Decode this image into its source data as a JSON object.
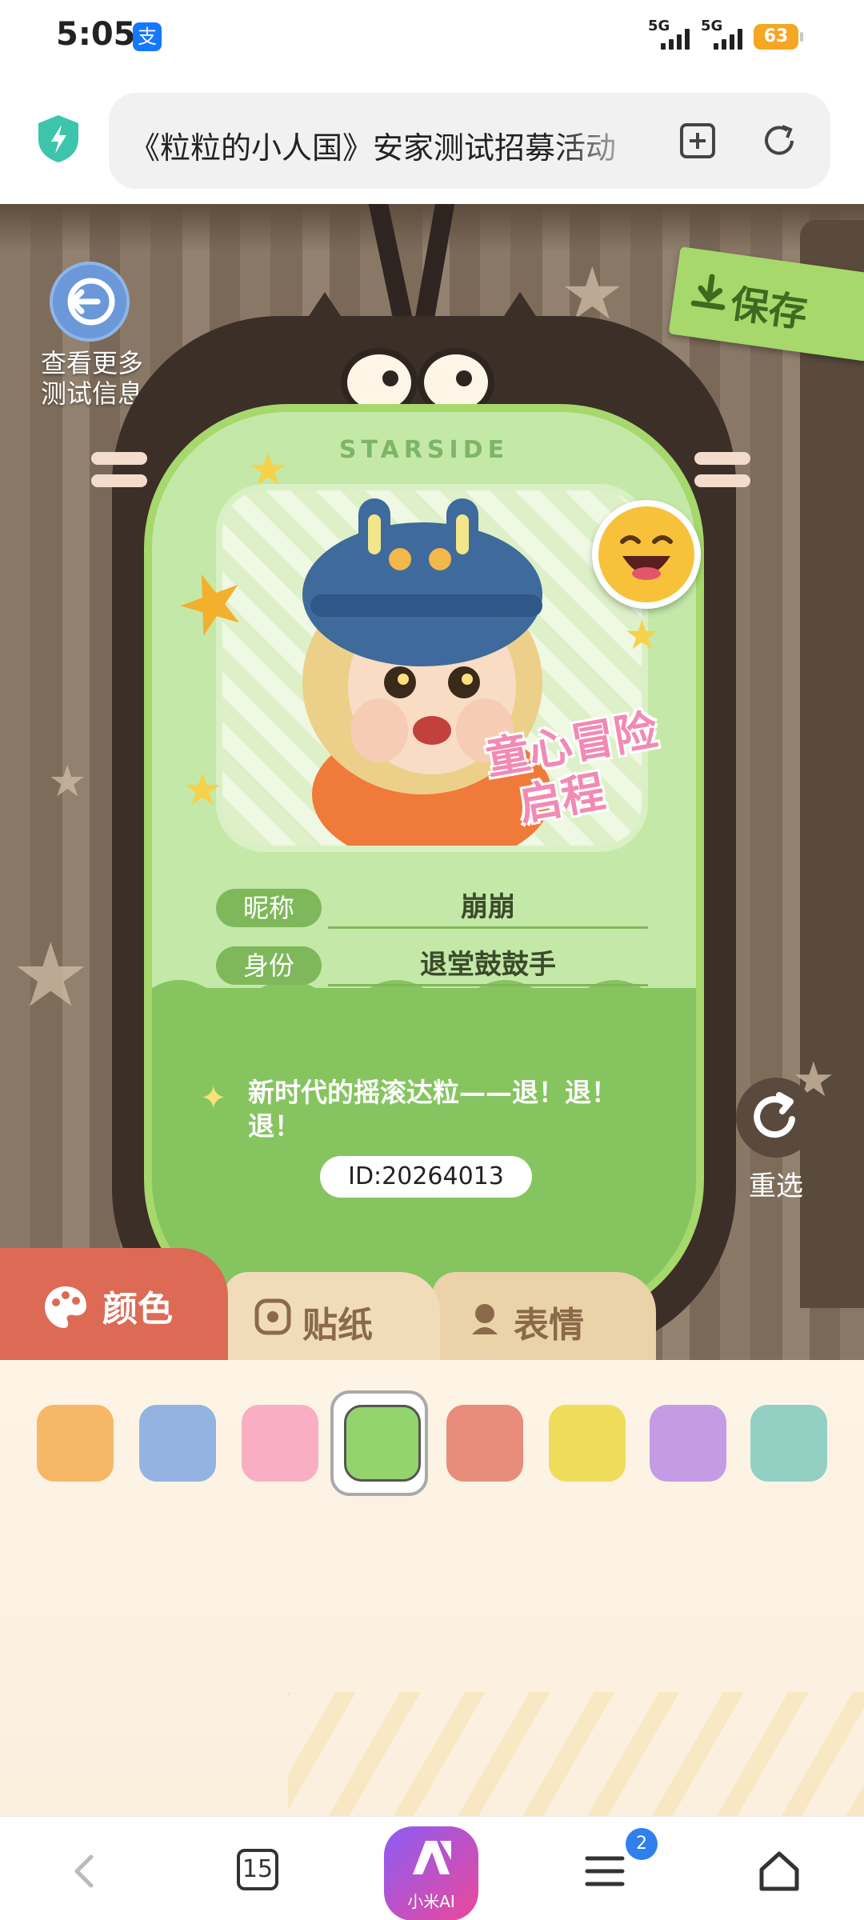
{
  "status_bar": {
    "time": "5:05",
    "pay_icon_glyph": "支",
    "network_1": "5G",
    "network_2": "5G",
    "battery": "63"
  },
  "browser": {
    "url_title": "《粒粒的小人国》安家测试招募活动",
    "icons": [
      "shield-bolt-icon",
      "add-bookmark-icon",
      "refresh-icon"
    ]
  },
  "game": {
    "back_label_line1": "查看更多",
    "back_label_line2": "测试信息",
    "save_label": "保存",
    "brand": "STARSIDE",
    "title_art_line1": "童心冒险",
    "title_art_line2": "启程",
    "nickname_label": "昵称",
    "nickname_value": "崩崩",
    "identity_label": "身份",
    "identity_value": "退堂鼓鼓手",
    "motto": "新时代的摇滚达粒——退！退！退！",
    "id_text": "ID:20264013",
    "reset_label": "重选"
  },
  "tabs": [
    {
      "label": "颜色",
      "icon": "palette-icon",
      "active": true
    },
    {
      "label": "贴纸",
      "icon": "sticker-icon",
      "active": false
    },
    {
      "label": "表情",
      "icon": "face-icon",
      "active": false
    }
  ],
  "palette": {
    "swatches": [
      "#f6b766",
      "#93b4e0",
      "#f9aec4",
      "#93d46c",
      "#e88d7b",
      "#efdc5b",
      "#c49ce6",
      "#93d0c4"
    ],
    "selected_index": 3
  },
  "nav": {
    "tab_count": "15",
    "ai_label": "小米AI",
    "menu_badge": "2"
  },
  "colors": {
    "card_green": "#a6d86b",
    "badge_brown": "#3b2f28",
    "active_tab": "#dd6a55"
  }
}
